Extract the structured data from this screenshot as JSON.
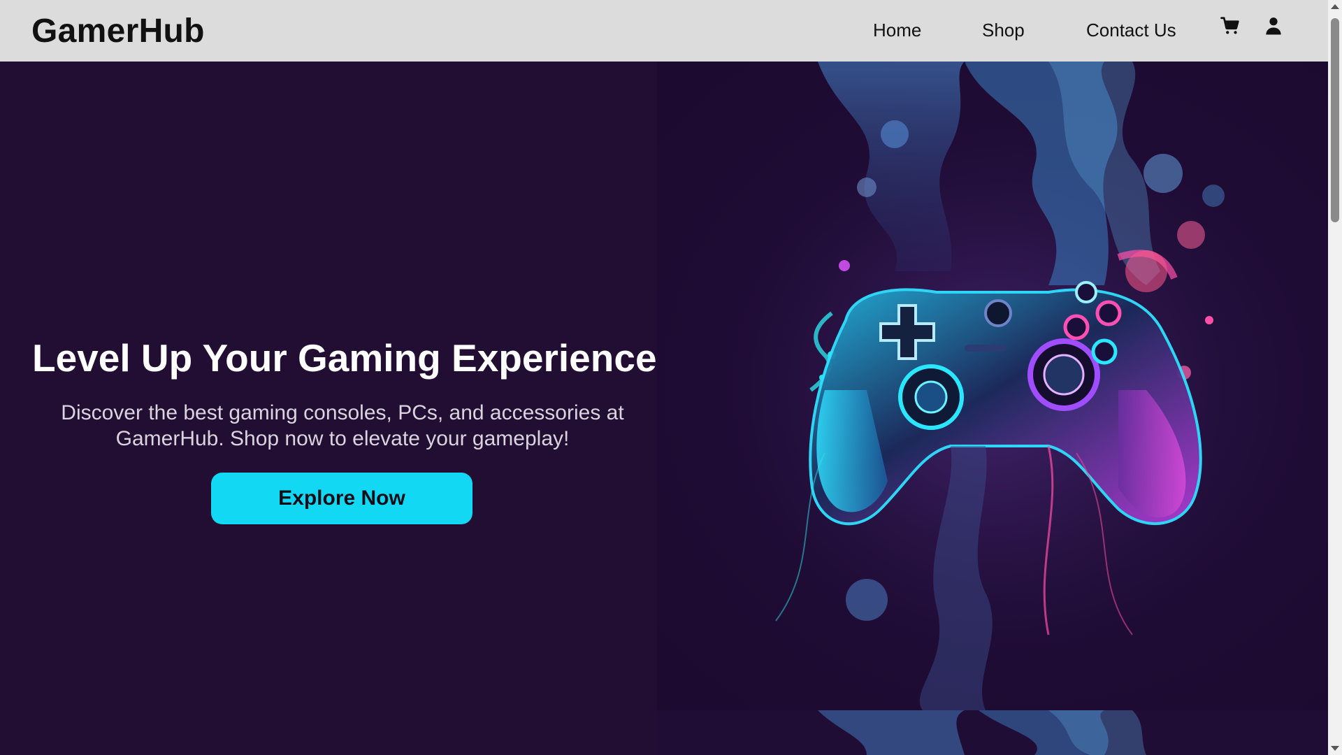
{
  "header": {
    "logo": "GamerHub",
    "nav": [
      {
        "label": "Home"
      },
      {
        "label": "Shop"
      },
      {
        "label": "Contact Us"
      }
    ],
    "icons": [
      "cart-icon",
      "user-icon"
    ]
  },
  "hero": {
    "title": "Level Up Your Gaming Experience",
    "subtitle": "Discover the best gaming consoles, PCs, and accessories at GamerHub. Shop now to elevate your gameplay!",
    "cta_label": "Explore Now"
  },
  "colors": {
    "header_bg": "#dcdcdc",
    "hero_bg": "#220d33",
    "accent": "#13d8f3",
    "neon_pink": "#ff3fb4",
    "neon_cyan": "#2be6ff",
    "neon_purple": "#a04cff"
  }
}
